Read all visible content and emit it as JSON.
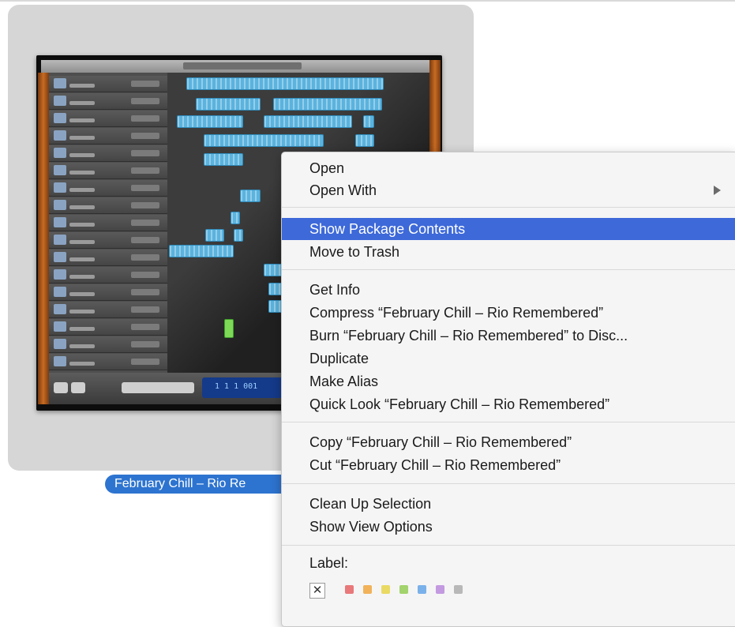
{
  "file": {
    "name": "February Chill – Rio Re",
    "thumbnail_lcd_text": "1 1 1 001",
    "thumbnail_icon": "garageband-project-thumbnail-icon"
  },
  "context_menu": {
    "groups": [
      [
        {
          "label": "Open"
        },
        {
          "label": "Open With",
          "has_submenu": true
        }
      ],
      [
        {
          "label": "Show Package Contents",
          "highlighted": true
        },
        {
          "label": "Move to Trash"
        }
      ],
      [
        {
          "label": "Get Info"
        },
        {
          "label": "Compress “February Chill – Rio Remembered”"
        },
        {
          "label": "Burn “February Chill – Rio Remembered” to Disc..."
        },
        {
          "label": "Duplicate"
        },
        {
          "label": "Make Alias"
        },
        {
          "label": "Quick Look “February Chill – Rio Remembered”"
        }
      ],
      [
        {
          "label": "Copy “February Chill – Rio Remembered”"
        },
        {
          "label": "Cut “February Chill – Rio Remembered”"
        }
      ],
      [
        {
          "label": "Clean Up Selection"
        },
        {
          "label": "Show View Options"
        }
      ]
    ],
    "label_section": {
      "title": "Label:",
      "none_glyph": "✕",
      "colors": [
        "#e8787a",
        "#f1b25a",
        "#e9da64",
        "#a3d36c",
        "#7ab1ea",
        "#c39ae0",
        "#b8b8b8"
      ]
    }
  },
  "colors": {
    "highlight": "#3d69d9",
    "selection_pill": "#2d74d0"
  }
}
